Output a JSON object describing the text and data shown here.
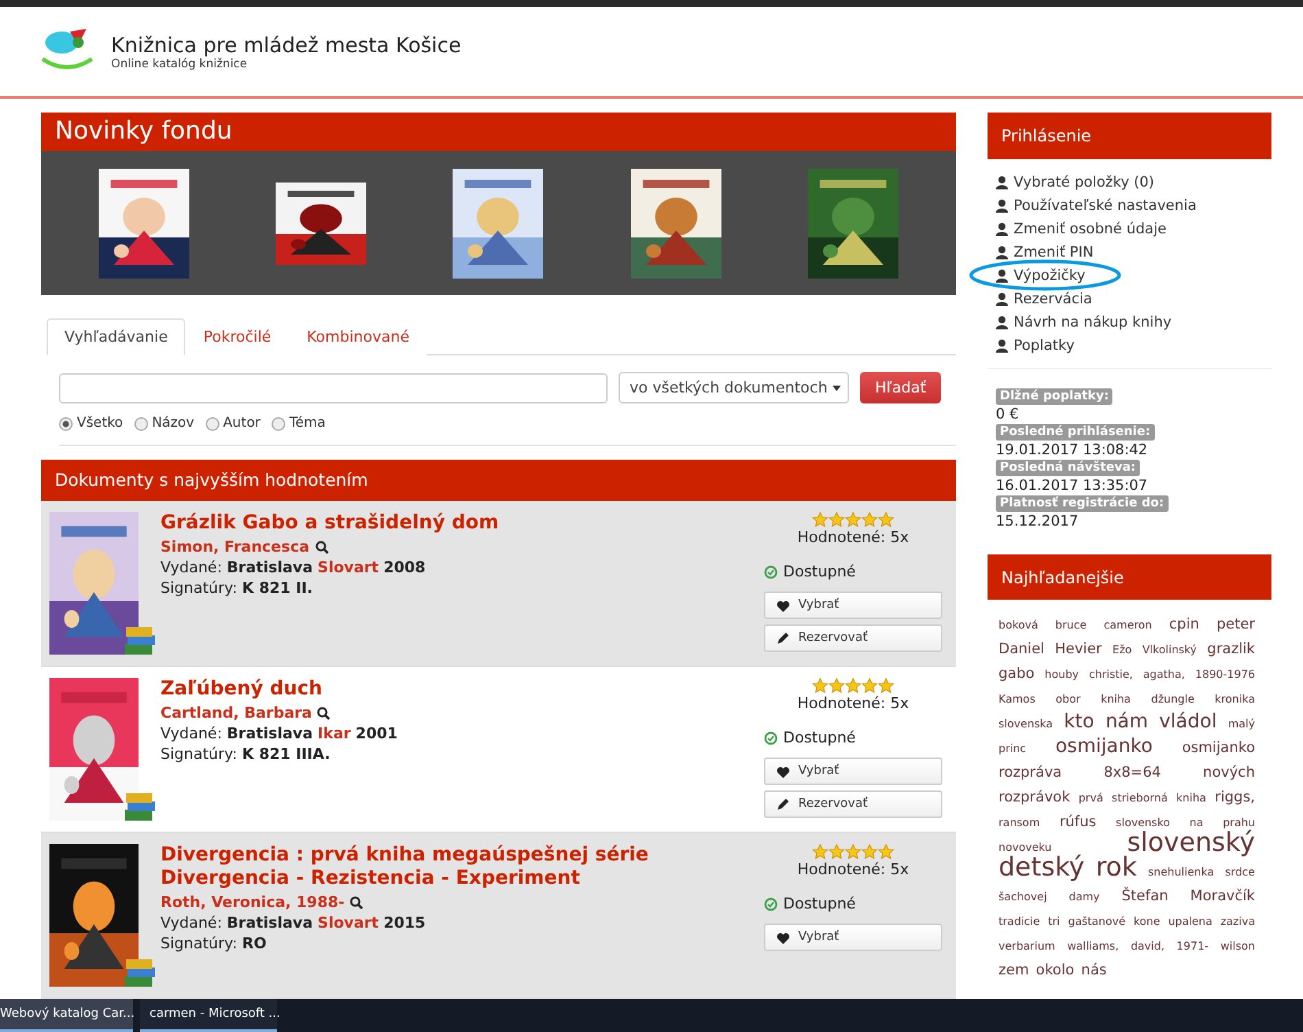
{
  "header": {
    "title": "Knižnica pre mládež mesta Košice",
    "subtitle": "Online katalóg knižnice"
  },
  "news": {
    "title": "Novinky fondu"
  },
  "search": {
    "tabs": [
      {
        "label": "Vyhľadávanie",
        "selected": true
      },
      {
        "label": "Pokročilé",
        "selected": false
      },
      {
        "label": "Kombinované",
        "selected": false
      }
    ],
    "scope": "vo všetkých dokumentoch",
    "button": "Hľadať",
    "radios": [
      {
        "label": "Všetko",
        "selected": true
      },
      {
        "label": "Názov",
        "selected": false
      },
      {
        "label": "Autor",
        "selected": false
      },
      {
        "label": "Téma",
        "selected": false
      }
    ]
  },
  "top_rated": {
    "title": "Dokumenty s najvyšším hodnotením",
    "items": [
      {
        "title": "Grázlik Gabo a strašidelný dom",
        "author": "Simon, Francesca",
        "published_label": "Vydané:",
        "place": "Bratislava",
        "publisher": "Slovart",
        "year": "2008",
        "signature_label": "Signatúry:",
        "signature": "K 821 II.",
        "stars": 5,
        "rating": "Hodnotené: 5x",
        "availability": "Dostupné",
        "buttons": [
          {
            "kind": "select",
            "label": "Vybrať"
          },
          {
            "kind": "reserve",
            "label": "Rezervovať"
          }
        ]
      },
      {
        "title": "Zaľúbený duch",
        "author": "Cartland, Barbara",
        "published_label": "Vydané:",
        "place": "Bratislava",
        "publisher": "Ikar",
        "year": "2001",
        "signature_label": "Signatúry:",
        "signature": "K 821 IIIA.",
        "stars": 5,
        "rating": "Hodnotené: 5x",
        "availability": "Dostupné",
        "buttons": [
          {
            "kind": "select",
            "label": "Vybrať"
          },
          {
            "kind": "reserve",
            "label": "Rezervovať"
          }
        ]
      },
      {
        "title": "Divergencia : prvá kniha megaúspešnej série Divergencia - Rezistencia - Experiment",
        "author": "Roth, Veronica, 1988-",
        "published_label": "Vydané:",
        "place": "Bratislava",
        "publisher": "Slovart",
        "year": "2015",
        "signature_label": "Signatúry:",
        "signature": "RO",
        "stars": 5,
        "rating": "Hodnotené: 5x",
        "availability": "Dostupné",
        "buttons": [
          {
            "kind": "select",
            "label": "Vybrať"
          }
        ]
      }
    ]
  },
  "login": {
    "title": "Prihlásenie",
    "links": [
      {
        "label": "Vybraté položky (0)",
        "annotated": false
      },
      {
        "label": "Používateľské nastavenia",
        "annotated": false
      },
      {
        "label": "Zmeniť osobné údaje",
        "annotated": false
      },
      {
        "label": "Zmeniť PIN",
        "annotated": false
      },
      {
        "label": "Výpožičky",
        "annotated": true
      },
      {
        "label": "Rezervácia",
        "annotated": false
      },
      {
        "label": "Návrh na nákup knihy",
        "annotated": false
      },
      {
        "label": "Poplatky",
        "annotated": false
      }
    ],
    "info": [
      {
        "label": "Dlžné poplatky:",
        "value": "0 €"
      },
      {
        "label": "Posledné prihlásenie:",
        "value": "19.01.2017 13:08:42"
      },
      {
        "label": "Posledná návšteva:",
        "value": "16.01.2017 13:35:07"
      },
      {
        "label": "Platnosť registrácie do:",
        "value": "15.12.2017"
      }
    ]
  },
  "popular": {
    "title": "Najhľadanejšie",
    "tags": [
      {
        "text": "boková",
        "kind": "small"
      },
      {
        "text": "bruce",
        "kind": "small"
      },
      {
        "text": "cameron",
        "kind": "small"
      },
      {
        "text": "cpin",
        "kind": "medium"
      },
      {
        "text": "peter",
        "kind": "medium"
      },
      {
        "text": "Daniel",
        "kind": "medium"
      },
      {
        "text": "Hevier",
        "kind": "medium"
      },
      {
        "text": "Ežo",
        "kind": "small"
      },
      {
        "text": "Vlkolinský",
        "kind": "small"
      },
      {
        "text": "grazlik",
        "kind": "medium"
      },
      {
        "text": "gabo",
        "kind": "medium"
      },
      {
        "text": "houby",
        "kind": "small"
      },
      {
        "text": "christie,",
        "kind": "small"
      },
      {
        "text": "agatha,",
        "kind": "small"
      },
      {
        "text": "1890-1976",
        "kind": "small"
      },
      {
        "text": "Kamos",
        "kind": "small"
      },
      {
        "text": "obor",
        "kind": "small"
      },
      {
        "text": "kniha",
        "kind": "small"
      },
      {
        "text": "džungle",
        "kind": "small"
      },
      {
        "text": "kronika",
        "kind": "small"
      },
      {
        "text": "slovenska",
        "kind": "small"
      },
      {
        "text": "kto",
        "kind": "large"
      },
      {
        "text": "nám",
        "kind": "large"
      },
      {
        "text": "vládol",
        "kind": "large"
      },
      {
        "text": "malý",
        "kind": "small"
      },
      {
        "text": "princ",
        "kind": "small"
      },
      {
        "text": "osmijanko",
        "kind": "large"
      },
      {
        "text": "osmijanko",
        "kind": "medium"
      },
      {
        "text": "rozpráva",
        "kind": "medium"
      },
      {
        "text": "8x8=64",
        "kind": "medium"
      },
      {
        "text": "nových",
        "kind": "medium"
      },
      {
        "text": "rozprávok",
        "kind": "medium"
      },
      {
        "text": "prvá",
        "kind": "small"
      },
      {
        "text": "strieborná",
        "kind": "small"
      },
      {
        "text": "kniha",
        "kind": "small"
      },
      {
        "text": "riggs,",
        "kind": "medium"
      },
      {
        "text": "ransom",
        "kind": "small"
      },
      {
        "text": "rúfus",
        "kind": "medium"
      },
      {
        "text": "slovensko",
        "kind": "small"
      },
      {
        "text": "na",
        "kind": "small"
      },
      {
        "text": "prahu",
        "kind": "small"
      },
      {
        "text": "novoveku",
        "kind": "small"
      },
      {
        "text": "slovenský",
        "kind": "xlarge"
      },
      {
        "text": "detský",
        "kind": "xlarge"
      },
      {
        "text": "rok",
        "kind": "xlarge"
      },
      {
        "text": "snehulienka",
        "kind": "small"
      },
      {
        "text": "srdce",
        "kind": "small"
      },
      {
        "text": "šachovej",
        "kind": "small"
      },
      {
        "text": "damy",
        "kind": "small"
      },
      {
        "text": "Štefan",
        "kind": "medium"
      },
      {
        "text": "Moravčík",
        "kind": "medium"
      },
      {
        "text": "tradicie",
        "kind": "small"
      },
      {
        "text": "tri",
        "kind": "small"
      },
      {
        "text": "gaštanové",
        "kind": "small"
      },
      {
        "text": "kone",
        "kind": "small"
      },
      {
        "text": "upalena",
        "kind": "small"
      },
      {
        "text": "zaziva",
        "kind": "small"
      },
      {
        "text": "verbarium",
        "kind": "small"
      },
      {
        "text": "walliams,",
        "kind": "small"
      },
      {
        "text": "david,",
        "kind": "small"
      },
      {
        "text": "1971-",
        "kind": "small"
      },
      {
        "text": "wilson",
        "kind": "small"
      },
      {
        "text": "zem",
        "kind": "medium"
      },
      {
        "text": "okolo",
        "kind": "medium"
      },
      {
        "text": "nás",
        "kind": "medium"
      }
    ]
  },
  "taskbar": [
    {
      "label": "Webový katalog Car...",
      "selected": true
    },
    {
      "label": "carmen - Microsoft ...",
      "selected": false
    }
  ]
}
